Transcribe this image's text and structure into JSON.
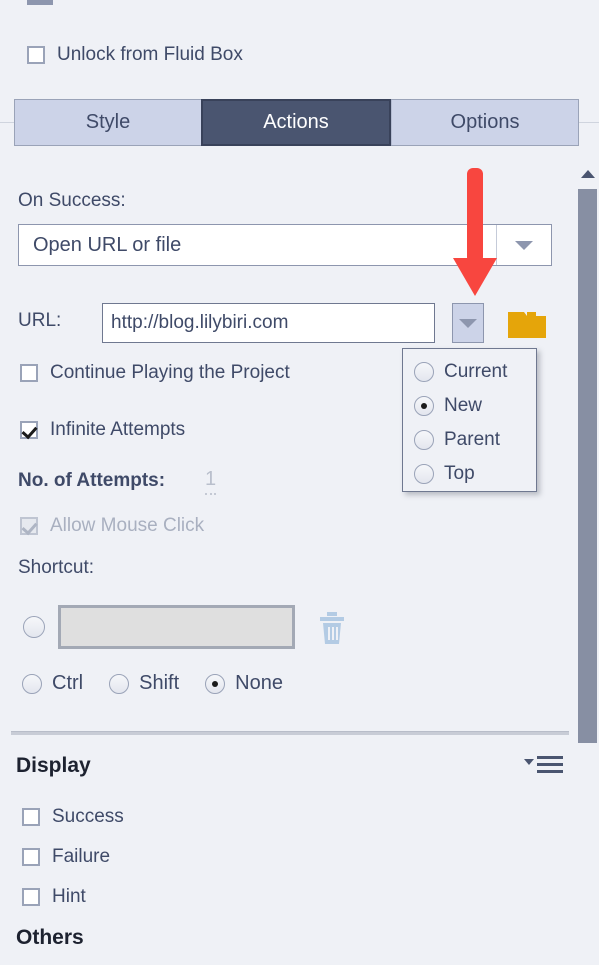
{
  "fluid_box": {
    "label": "Unlock from Fluid Box",
    "checked": false
  },
  "tabs": [
    {
      "label": "Style",
      "active": false
    },
    {
      "label": "Actions",
      "active": true
    },
    {
      "label": "Options",
      "active": false
    }
  ],
  "actions": {
    "on_success_label": "On Success:",
    "on_success_value": "Open URL or file",
    "url_label": "URL:",
    "url_value": "http://blog.lilybiri.com",
    "url_placeholder": "",
    "browse_icon": "folder-icon",
    "target_dropdown_icon": "chevron-down-icon",
    "target_options": [
      {
        "label": "Current",
        "selected": false
      },
      {
        "label": "New",
        "selected": true
      },
      {
        "label": "Parent",
        "selected": false
      },
      {
        "label": "Top",
        "selected": false
      }
    ],
    "continue_playing": {
      "label": "Continue Playing the Project",
      "checked": false
    },
    "infinite_attempts": {
      "label": "Infinite Attempts",
      "checked": true
    },
    "no_of_attempts": {
      "label": "No. of Attempts:",
      "value": "1"
    },
    "allow_mouse_click": {
      "label": "Allow Mouse Click",
      "checked": true,
      "disabled": true
    },
    "shortcut": {
      "label": "Shortcut:",
      "field_value": "",
      "delete_icon": "trash-icon",
      "modifiers": [
        {
          "label": "Ctrl",
          "selected": false
        },
        {
          "label": "Shift",
          "selected": false
        },
        {
          "label": "None",
          "selected": true
        }
      ]
    }
  },
  "display": {
    "title": "Display",
    "menu_icon": "hamburger-menu-icon",
    "items": [
      {
        "label": "Success",
        "checked": false
      },
      {
        "label": "Failure",
        "checked": false
      },
      {
        "label": "Hint",
        "checked": false
      }
    ]
  },
  "others": {
    "title": "Others"
  },
  "annotation": {
    "arrow_color": "#f8463f",
    "points_to": "url-target-dropdown-button"
  },
  "colors": {
    "panel_bg": "#eff1f6",
    "tab_inactive": "#ccd3e8",
    "tab_active": "#4a5570",
    "folder": "#e5a50a",
    "scrollbar": "#878fa3"
  }
}
